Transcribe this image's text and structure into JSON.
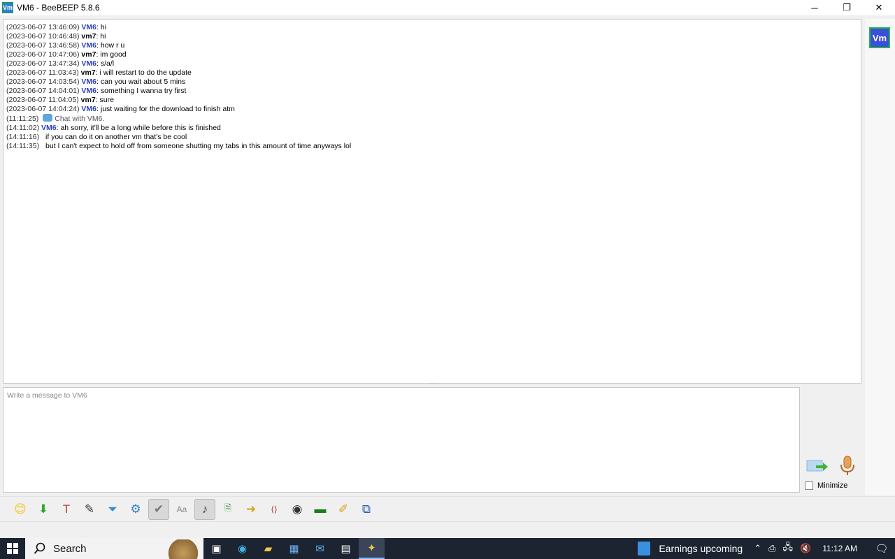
{
  "window": {
    "title": "VM6 - BeeBEEP 5.8.6",
    "icon_label": "Vm"
  },
  "win_controls": {
    "minimize": "─",
    "restore": "❐",
    "close": "✕"
  },
  "chat": {
    "history": [
      {
        "ts": "(2023-06-07 13:46:09)",
        "nick": "VM6",
        "msg": "hi"
      },
      {
        "ts": "(2023-06-07 10:46:48)",
        "nick": "vm7",
        "msg": "hi"
      },
      {
        "ts": "(2023-06-07 13:46:58)",
        "nick": "VM6",
        "msg": "how r u"
      },
      {
        "ts": "(2023-06-07 10:47:06)",
        "nick": "vm7",
        "msg": "im good"
      },
      {
        "ts": "(2023-06-07 13:47:34)",
        "nick": "VM6",
        "msg": "s/a/l"
      },
      {
        "ts": "(2023-06-07 11:03:43)",
        "nick": "vm7",
        "msg": "i will restart to do the update"
      },
      {
        "ts": "(2023-06-07 14:03:54)",
        "nick": "VM6",
        "msg": "can you wait about 5 mins"
      },
      {
        "ts": "(2023-06-07 14:04:01)",
        "nick": "VM6",
        "msg": "something I wanna try first"
      },
      {
        "ts": "(2023-06-07 11:04:05)",
        "nick": "vm7",
        "msg": "sure"
      },
      {
        "ts": "(2023-06-07 14:04:24)",
        "nick": "VM6",
        "msg": "just waiting for the download to finish atm"
      }
    ],
    "system": {
      "ts": "(11:11:25)",
      "text": "Chat with VM6."
    },
    "recent": [
      {
        "ts": "(14:11:02)",
        "nick": "VM6",
        "msg": "ah sorry, it'll be a long while before this is finished"
      },
      {
        "ts": "(14:11:16)",
        "nick": "",
        "msg": "if you can do it on another vm that's be cool"
      },
      {
        "ts": "(14:11:35)",
        "nick": "",
        "msg": "but I can't expect to hold off from someone shutting my tabs in this amount of time anyways lol"
      }
    ]
  },
  "sidebar": {
    "avatar_label": "Vm"
  },
  "input": {
    "placeholder": "Write a message to VM6",
    "value": ""
  },
  "minimize_label": "Minimize",
  "toolbar": {
    "buttons": [
      {
        "name": "emoticon-icon",
        "glyph": "😊"
      },
      {
        "name": "download-icon",
        "glyph": "⬇"
      },
      {
        "name": "font-icon",
        "glyph": "T"
      },
      {
        "name": "color-pen-icon",
        "glyph": "✎"
      },
      {
        "name": "filter-icon",
        "glyph": "⏷"
      },
      {
        "name": "settings-icon",
        "glyph": "⚙"
      },
      {
        "name": "spellcheck-icon",
        "glyph": "✔"
      },
      {
        "name": "word-complete-icon",
        "glyph": "Aa"
      },
      {
        "name": "sound-icon",
        "glyph": "♪"
      },
      {
        "name": "save-chat-icon",
        "glyph": "🗎"
      },
      {
        "name": "send-file-icon",
        "glyph": "➜"
      },
      {
        "name": "html-icon",
        "glyph": "⟨⟩"
      },
      {
        "name": "screenshot-icon",
        "glyph": "◉"
      },
      {
        "name": "terminal-icon",
        "glyph": "▬"
      },
      {
        "name": "note-icon",
        "glyph": "✐"
      },
      {
        "name": "detach-window-icon",
        "glyph": "⧉"
      }
    ]
  },
  "taskbar": {
    "search_label": "Search",
    "news_label": "Earnings upcoming",
    "time": "11:12 AM"
  }
}
